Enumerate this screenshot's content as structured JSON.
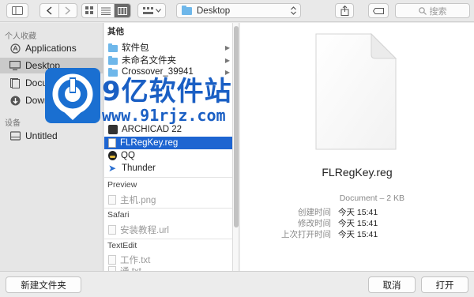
{
  "toolbar": {
    "location": "Desktop",
    "search_placeholder": "搜索"
  },
  "sidebar": {
    "favorites_header": "个人收藏",
    "favorites": [
      {
        "label": "Applications",
        "icon": "applications-icon"
      },
      {
        "label": "Desktop",
        "icon": "desktop-icon",
        "selected": true
      },
      {
        "label": "Documents",
        "icon": "documents-icon"
      },
      {
        "label": "Downloads",
        "icon": "downloads-icon"
      }
    ],
    "devices_header": "设备",
    "devices": [
      {
        "label": "Untitled",
        "icon": "disk-icon"
      }
    ]
  },
  "column": {
    "group_other": "其他",
    "other_items": [
      {
        "label": "软件包",
        "type": "folder",
        "has_children": true
      },
      {
        "label": "未命名文件夹",
        "type": "folder",
        "has_children": true
      },
      {
        "label": "Crossover_39941",
        "type": "folder",
        "has_children": true
      },
      {
        "label": "ARCHICAD 22",
        "type": "app"
      },
      {
        "label": "FLRegKey.reg",
        "type": "doc",
        "selected": true
      },
      {
        "label": "QQ",
        "type": "qq"
      },
      {
        "label": "Thunder",
        "type": "thunder"
      }
    ],
    "group_preview": "Preview",
    "preview_items": [
      {
        "label": "主机.png",
        "type": "doc"
      }
    ],
    "group_safari": "Safari",
    "safari_items": [
      {
        "label": "安装教程.url",
        "type": "doc"
      }
    ],
    "group_textedit": "TextEdit",
    "textedit_items": [
      {
        "label": "工作.txt",
        "type": "doc"
      },
      {
        "label": "通.txt",
        "type": "doc"
      }
    ]
  },
  "preview": {
    "file_name": "FLRegKey.reg",
    "kind": "Document – 2 KB",
    "created_label": "创建时间",
    "created_value": "今天 15:41",
    "modified_label": "修改时间",
    "modified_value": "今天 15:41",
    "opened_label": "上次打开时间",
    "opened_value": "今天 15:41"
  },
  "buttons": {
    "new_folder": "新建文件夹",
    "cancel": "取消",
    "open": "打开"
  },
  "watermark": {
    "title": "9亿软件站",
    "url": "www.91rjz.com"
  },
  "colors": {
    "selection": "#1e65d1",
    "folder": "#6eb7ea",
    "watermark": "#1a6fd1"
  }
}
